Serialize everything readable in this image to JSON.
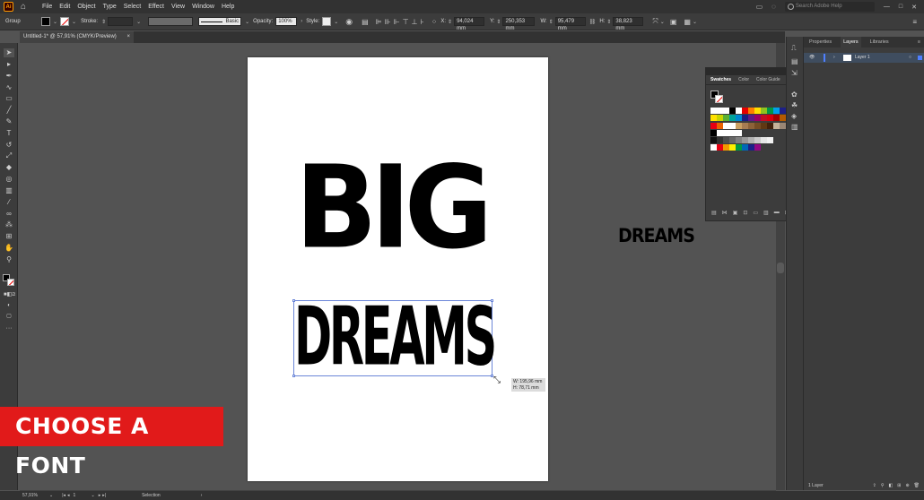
{
  "menubar": {
    "items": [
      "File",
      "Edit",
      "Object",
      "Type",
      "Select",
      "Effect",
      "View",
      "Window",
      "Help"
    ],
    "search_placeholder": "Search Adobe Help"
  },
  "control": {
    "selection_label": "Group",
    "stroke_label": "Stroke:",
    "brush_label": "Basic",
    "opacity_label": "Opacity:",
    "opacity_value": "100%",
    "style_label": "Style:",
    "x_label": "X:",
    "x_value": "94,024 mm",
    "y_label": "Y:",
    "y_value": "250,353 mm",
    "w_label": "W:",
    "w_value": "95,479 mm",
    "h_label": "H:",
    "h_value": "38,823 mm"
  },
  "document_tab": {
    "title": "Untitled-1* @ 57,91% (CMYK/Preview)",
    "close": "×"
  },
  "canvas": {
    "big_text": "BIG",
    "dreams_text": "DREAMS",
    "dreams_copy_text": "DREAMS",
    "tooltip_w": "W: 195,96 mm",
    "tooltip_h": "H: 78,71 mm"
  },
  "banner": {
    "text": "CHOOSE A FONT"
  },
  "swatches_panel": {
    "tabs": [
      "Swatches",
      "Color",
      "Color Guide"
    ],
    "active_tab": "Swatches"
  },
  "right_panel": {
    "tabs": [
      "Properties",
      "Layers",
      "Libraries"
    ],
    "active_tab": "Layers",
    "layer_name": "Layer 1",
    "footer_label": "1 Layer"
  },
  "statusbar": {
    "zoom": "57,91%",
    "artboard_num": "1",
    "tool_name": "Selection"
  },
  "colors": {
    "banner": "#e11a1a",
    "selection": "#6b86d8"
  }
}
